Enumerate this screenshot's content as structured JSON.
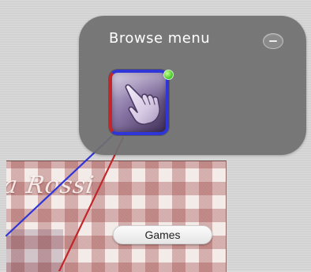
{
  "browse_menu": {
    "title": "Browse menu",
    "collapse_icon": "minus-icon",
    "node": {
      "icon": "pointing-hand-icon",
      "status": "connected",
      "status_color": "#3fc626",
      "border_colors": [
        "#c2262a",
        "#2f35d6"
      ]
    }
  },
  "background": {
    "brand_text": "a Rossi",
    "games_button_label": "Games"
  },
  "connections": [
    {
      "color": "#2f35d6"
    },
    {
      "color": "#c2262a"
    }
  ]
}
